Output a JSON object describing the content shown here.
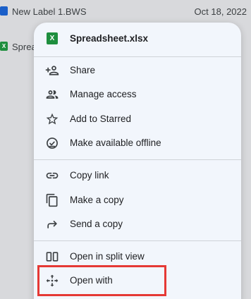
{
  "background": {
    "rows": [
      {
        "name": "New Label 1.BWS",
        "date": "Oct 18, 2022",
        "icon": "document-icon"
      },
      {
        "name": "Sprea",
        "date": "",
        "icon": "spreadsheet-icon"
      }
    ]
  },
  "menu": {
    "title": "Spreadsheet.xlsx",
    "badge_letter": "X",
    "items": [
      {
        "label": "Share",
        "icon": "person-add-icon"
      },
      {
        "label": "Manage access",
        "icon": "people-icon"
      },
      {
        "label": "Add to Starred",
        "icon": "star-icon"
      },
      {
        "label": "Make available offline",
        "icon": "offline-check-icon"
      },
      {
        "label": "Copy link",
        "icon": "link-icon"
      },
      {
        "label": "Make a copy",
        "icon": "copy-icon"
      },
      {
        "label": "Send a copy",
        "icon": "forward-arrow-icon"
      },
      {
        "label": "Open in split view",
        "icon": "split-view-icon"
      },
      {
        "label": "Open with",
        "icon": "open-with-icon"
      }
    ]
  },
  "colors": {
    "menu_background": "#f2f6fc",
    "highlight_border": "#e53935",
    "spreadsheet_green": "#1e8e3e",
    "doc_blue": "#1a5fc9"
  }
}
